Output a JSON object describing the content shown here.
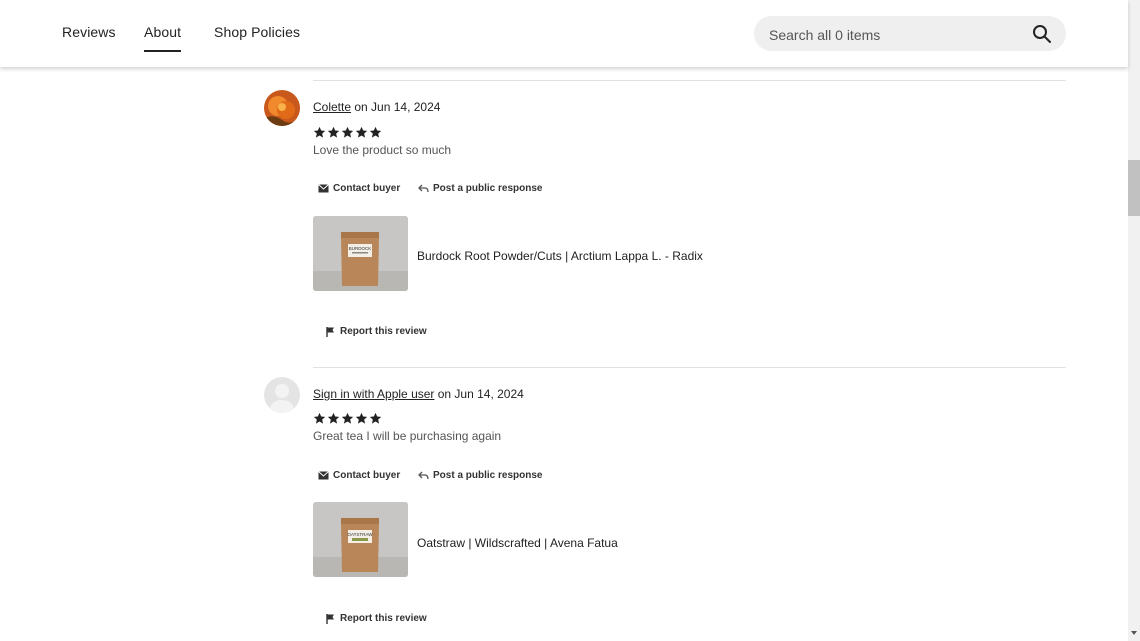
{
  "nav": {
    "tabs": [
      {
        "label": "Reviews"
      },
      {
        "label": "About",
        "active": true
      },
      {
        "label": "Shop Policies"
      }
    ],
    "search": {
      "placeholder": "Search all 0 items",
      "value": ""
    }
  },
  "reviews": [
    {
      "reviewer": "Colette",
      "date_text": "on Jun 14, 2024",
      "rating": 5,
      "text": "Love the product so much",
      "contact_label": "Contact buyer",
      "respond_label": "Post a public response",
      "product_title": "Burdock Root Powder/Cuts | Arctium Lappa L. - Radix",
      "product_pack_label": "BURDOCK",
      "report_label": "Report this review",
      "avatar_icon": "orange-flower-avatar"
    },
    {
      "reviewer": "Sign in with Apple user",
      "date_text": "on Jun 14, 2024",
      "rating": 5,
      "text": "Great tea I will be purchasing again",
      "contact_label": "Contact buyer",
      "respond_label": "Post a public response",
      "product_title": "Oatstraw | Wildscrafted | Avena Fatua",
      "product_pack_label": "OATSTRAW",
      "report_label": "Report this review",
      "avatar_icon": "default-user-avatar"
    }
  ],
  "colors": {
    "star": "#222222",
    "divider": "#e1e1e1",
    "search_bg": "#efefef"
  }
}
